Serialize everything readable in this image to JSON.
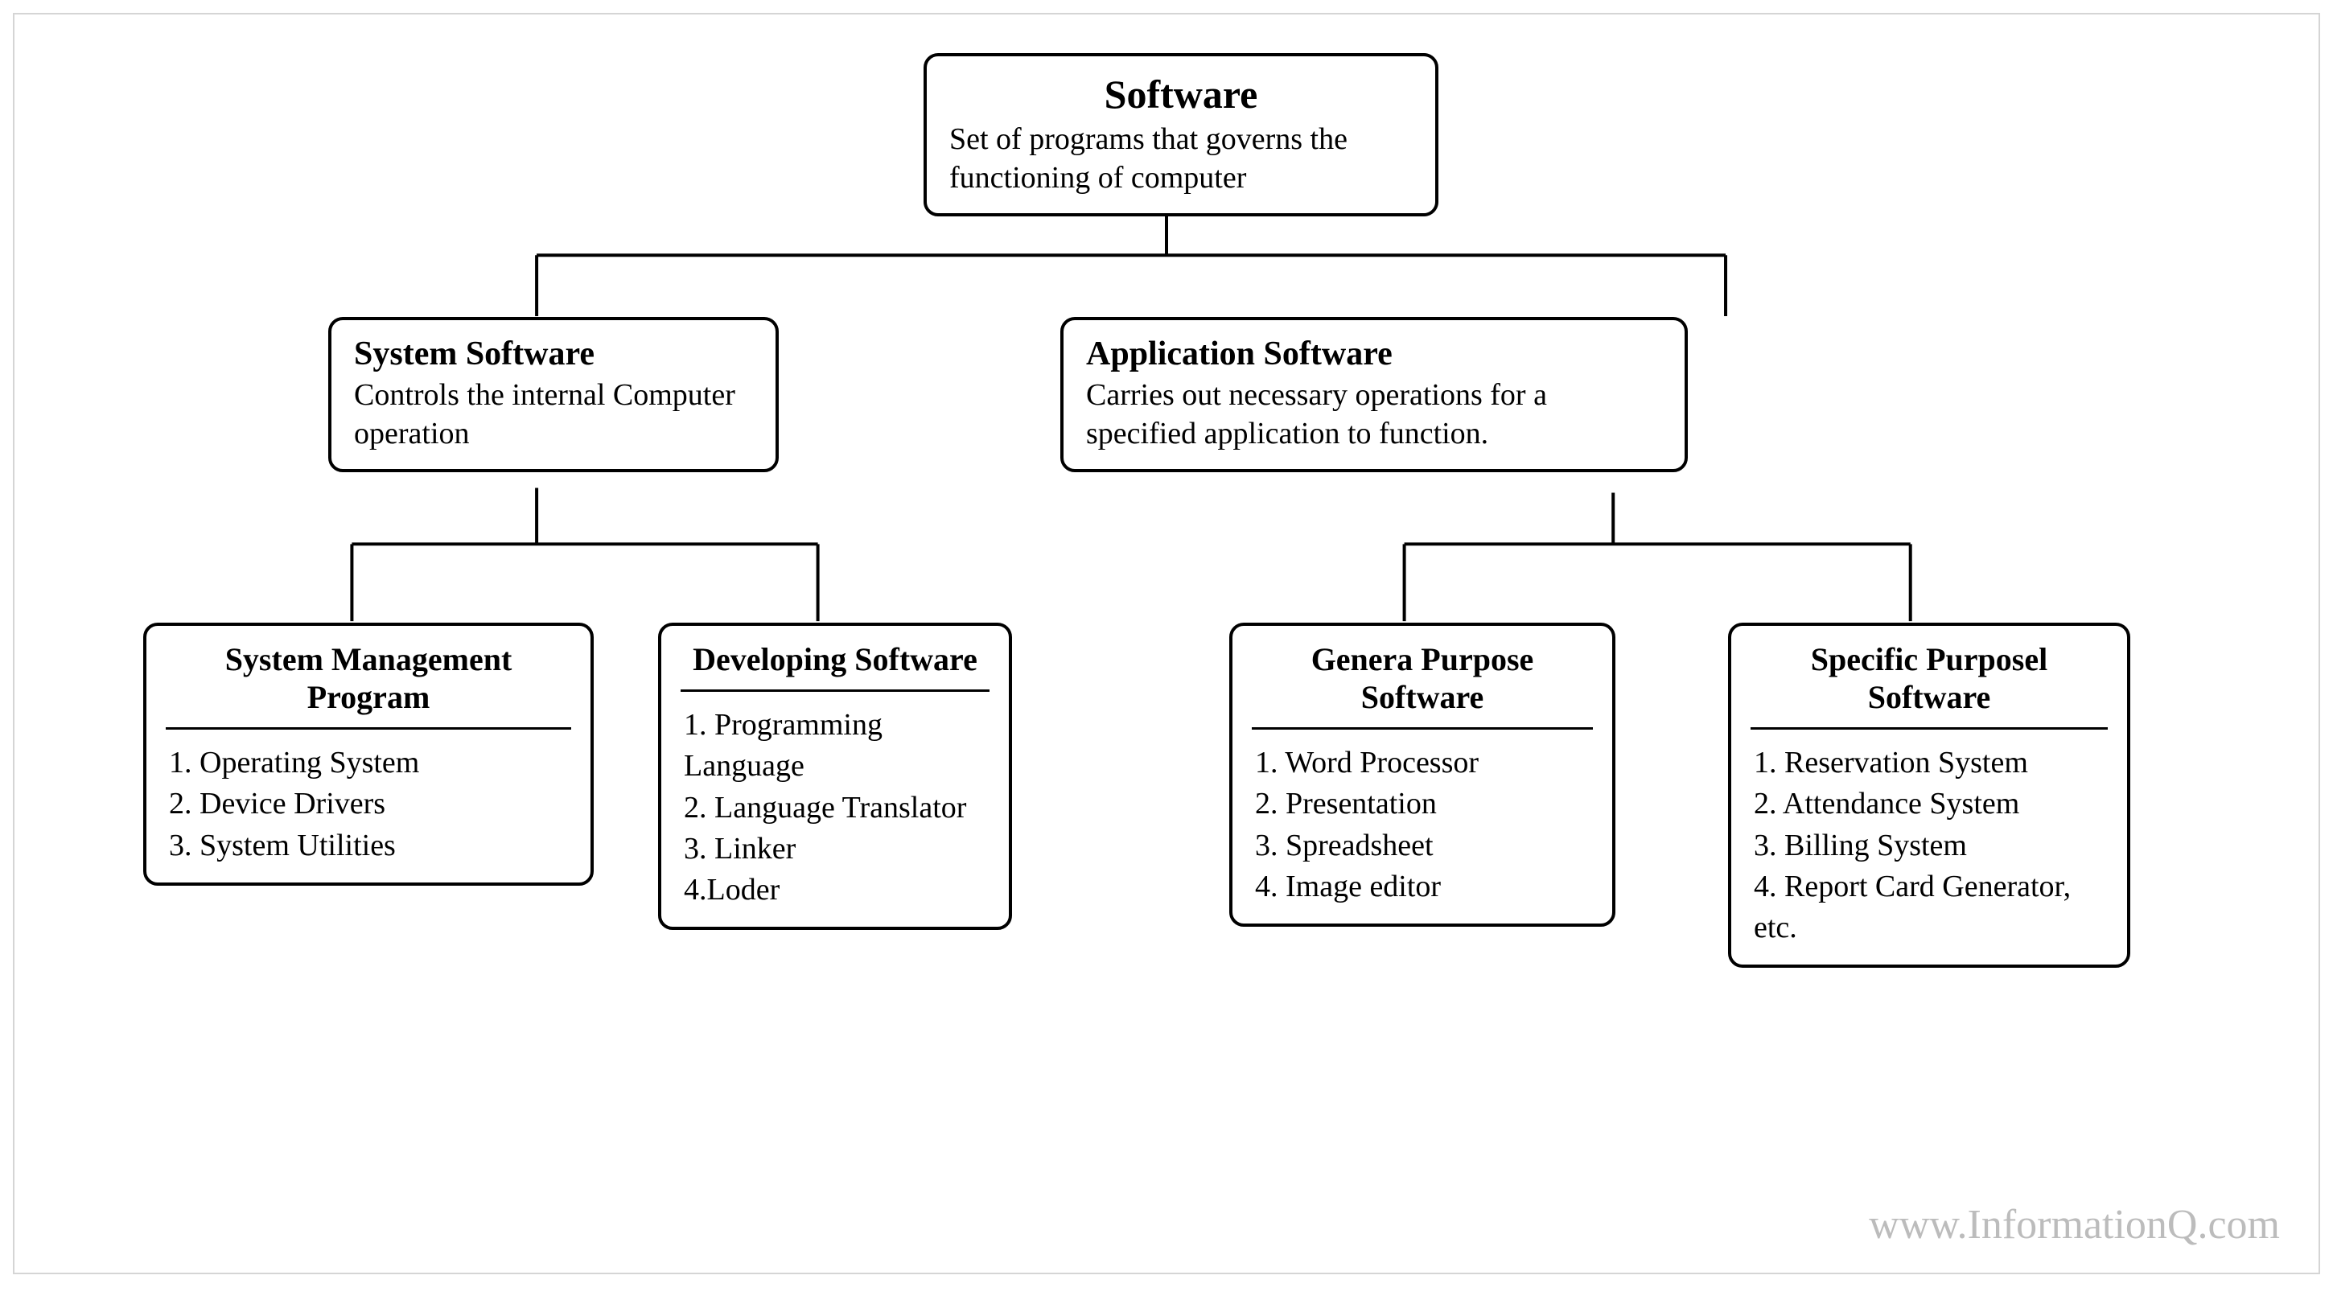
{
  "root": {
    "title": "Software",
    "desc": "Set of programs that governs the  functioning of computer"
  },
  "system": {
    "title": "System Software",
    "desc": "Controls the internal Computer operation"
  },
  "application": {
    "title": "Application Software",
    "desc": "Carries out necessary operations for a specified application to function."
  },
  "sys_mgmt": {
    "title": "System Management Program",
    "items": "1. Operating System\n2. Device Drivers\n3. System Utilities"
  },
  "developing": {
    "title": "Developing Software",
    "items": "1. Programming Language\n2. Language Translator\n3. Linker\n4.Loder"
  },
  "general": {
    "title": "Genera Purpose Software",
    "items": "1. Word Processor\n2. Presentation\n3. Spreadsheet\n4. Image editor"
  },
  "specific": {
    "title": "Specific Purposel Software",
    "items": "1. Reservation System\n2. Attendance System\n3. Billing System\n4. Report Card Generator, etc."
  },
  "watermark": "www.InformationQ.com"
}
